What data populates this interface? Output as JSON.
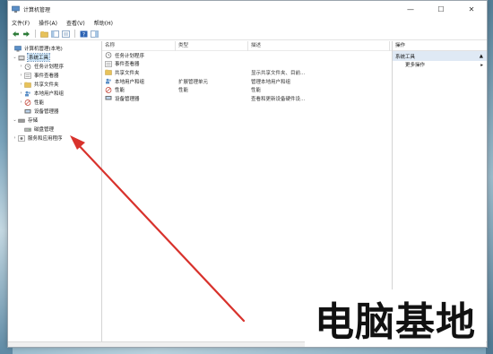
{
  "window": {
    "title": "计算机管理",
    "minimize_glyph": "—",
    "maximize_glyph": "☐",
    "close_glyph": "✕"
  },
  "menu": [
    "文件(F)",
    "操作(A)",
    "查看(V)",
    "帮助(H)"
  ],
  "toolbar": {
    "buttons": [
      "back-icon",
      "forward-icon",
      "up-folder-icon",
      "show-hide-tree-icon",
      "export-list-icon",
      "help-icon",
      "console-view-icon"
    ]
  },
  "tree": {
    "root": "计算机管理(本地)",
    "system_tools": "系统工具",
    "task_scheduler": "任务计划程序",
    "event_viewer": "事件查看器",
    "shared_folders": "共享文件夹",
    "local_users_groups": "本地用户和组",
    "performance": "性能",
    "device_manager": "设备管理器",
    "storage": "存储",
    "disk_management": "磁盘管理",
    "services_apps": "服务和应用程序"
  },
  "list": {
    "columns": [
      "名称",
      "类型",
      "描述"
    ],
    "rows": [
      {
        "name": "任务计划程序",
        "type": "",
        "desc": ""
      },
      {
        "name": "事件查看器",
        "type": "",
        "desc": ""
      },
      {
        "name": "共享文件夹",
        "type": "",
        "desc": "显示共享文件夹、目前..."
      },
      {
        "name": "本地用户和组",
        "type": "扩展管理单元",
        "desc": "管理本地用户和组"
      },
      {
        "name": "性能",
        "type": "性能",
        "desc": "性能"
      },
      {
        "name": "设备管理器",
        "type": "",
        "desc": "查看和更新设备硬件设..."
      }
    ]
  },
  "actions": {
    "header": "操作",
    "section": "系统工具",
    "more": "更多操作",
    "section_arrow": "▲",
    "more_arrow": "▸"
  },
  "watermark": "电脑基地",
  "colors": {
    "arrow": "#d8322c",
    "selection": "#cce4f7",
    "action_section_bg": "#dfe9f4"
  }
}
